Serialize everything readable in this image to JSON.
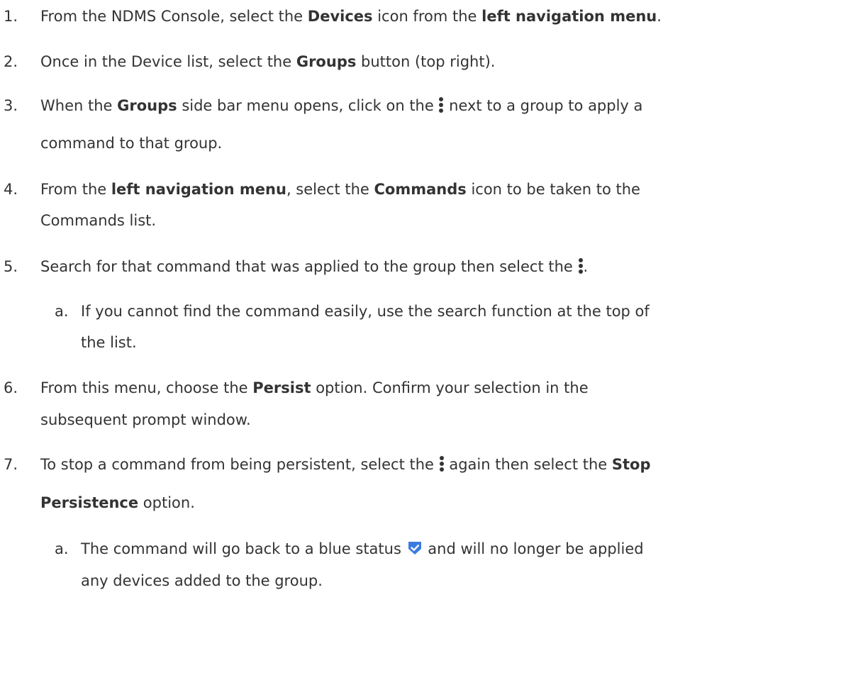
{
  "steps": [
    {
      "num": "1.",
      "s1": "From the NDMS Console, select the ",
      "b1": "Devices",
      "s2": " icon from the ",
      "b2": "left navigation menu",
      "s3": "."
    },
    {
      "num": "2.",
      "s1": "Once in the Device list, select the ",
      "b1": "Groups",
      "s2": " button (top right)."
    },
    {
      "num": "3.",
      "s1": "When the ",
      "b1": "Groups",
      "s2": " side bar menu opens, click on the ",
      "s3": " next to a group to apply a",
      "l2": "command to that group."
    },
    {
      "num": "4.",
      "s1": "From the ",
      "b1": "left navigation menu",
      "s2": ", select the ",
      "b2": "Commands",
      "s3": " icon to be taken to the",
      "l2": "Commands list."
    },
    {
      "num": "5.",
      "s1": " Search for that command that was applied to the group then select the ",
      "s2": "."
    },
    {
      "num": "6.",
      "s1": "From this menu, choose the ",
      "b1": "Persist",
      "s2": " option. Confirm your selection in the",
      "l2": "subsequent prompt window."
    },
    {
      "num": "7.",
      "s1": "To stop a command from being persistent, select the ",
      "s2": " again then select the ",
      "b1": "Stop",
      "b2": "Persistence",
      "s3": " option."
    }
  ],
  "substeps": [
    {
      "num": "a.",
      "l1": "If you cannot find the command easily, use the search function at the top of",
      "l2": "the list."
    },
    {
      "num": "a.",
      "s1": "The command will go back to a blue status ",
      "s2": " and will no longer be applied",
      "l2": "any devices added to the group."
    }
  ],
  "icons": {
    "kebab": "more-vert-icon",
    "check": "blue-check-status-icon"
  },
  "colors": {
    "text": "#333333",
    "check_blue": "#3b7be0"
  }
}
